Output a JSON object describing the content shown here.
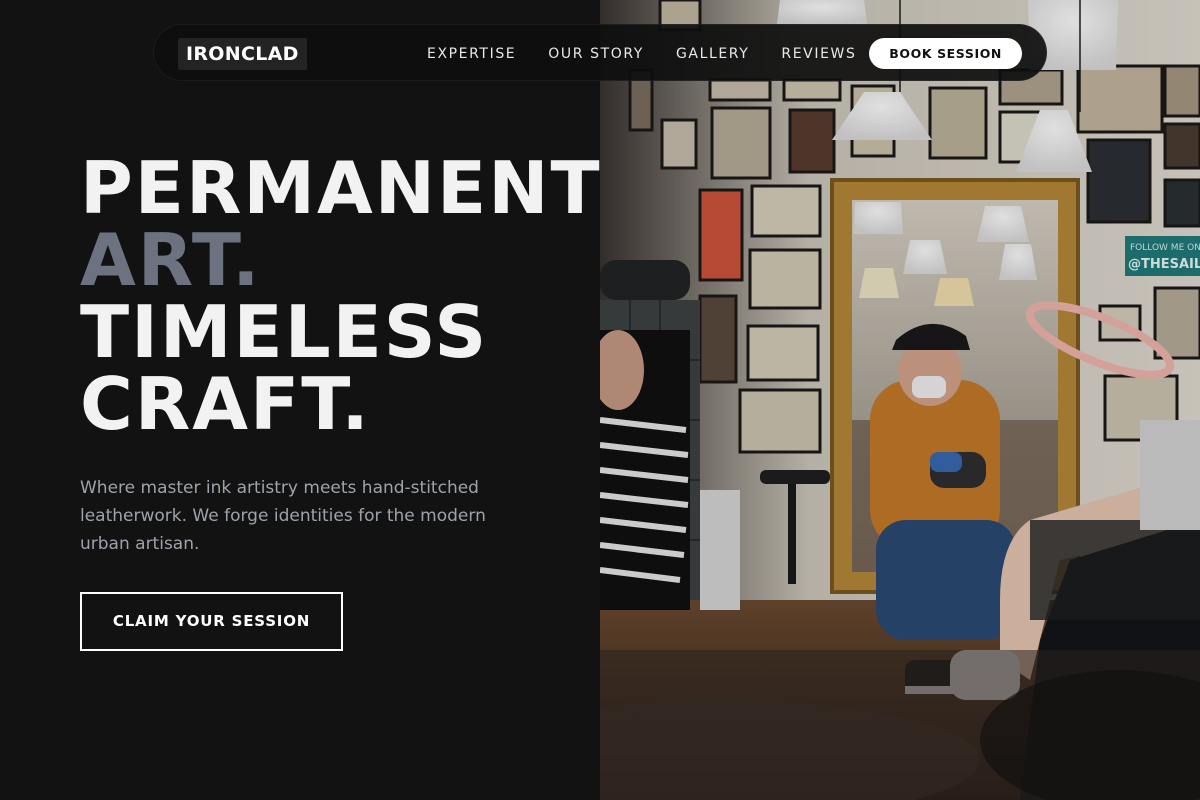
{
  "brand": {
    "logo_text": "IRONCLAD"
  },
  "nav": {
    "links": [
      "EXPERTISE",
      "OUR STORY",
      "GALLERY",
      "REVIEWS"
    ],
    "cta_label": "BOOK SESSION"
  },
  "hero": {
    "headline_line1": "PERMANENT",
    "headline_line2": "ART.",
    "headline_line3": "TIMELESS",
    "headline_line4": "CRAFT.",
    "description": "Where master ink artistry meets hand-stitched leatherwork. We forge identities for the modern urban artisan.",
    "cta_label": "CLAIM YOUR SESSION"
  },
  "photo": {
    "subject": "tattoo-studio-photo",
    "sign_text_1": "FOLLOW ME ON IN",
    "sign_text_2": "@THESAILOR"
  },
  "colors": {
    "background": "#121212",
    "headline": "#f2f2f2",
    "headline_accent": "#6c7280",
    "body_text": "#9ea3ab",
    "button_light": "#ffffff"
  }
}
